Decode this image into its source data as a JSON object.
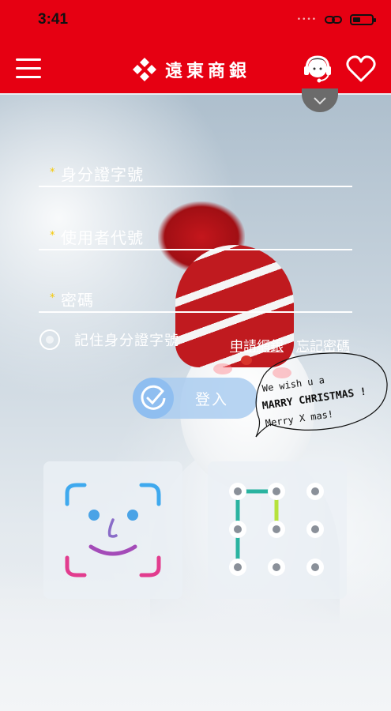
{
  "status_bar": {
    "time": "3:41",
    "signal": "••••"
  },
  "header": {
    "brand_name": "遠東商銀",
    "menu_icon": "hamburger-icon",
    "support_icon": "headset-agent-icon",
    "favorite_icon": "heart-icon",
    "accent": "#e60012"
  },
  "form": {
    "id_number": {
      "label": "身分證字號",
      "required_mark": "*"
    },
    "user_code": {
      "label": "使用者代號",
      "required_mark": "*"
    },
    "password": {
      "label": "密碼",
      "required_mark": "*"
    },
    "remember_label": "記住身分證字號",
    "apply_link": "申請網銀",
    "forgot_link": "忘記密碼",
    "login_label": "登入"
  },
  "greeting": {
    "line1": "We wish u a",
    "line2": "MARRY CHRISTMAS !",
    "line3": "Merry X mas!"
  },
  "quick_login": {
    "face_id_icon": "face-id-icon",
    "pattern_icon": "pattern-lock-icon"
  }
}
